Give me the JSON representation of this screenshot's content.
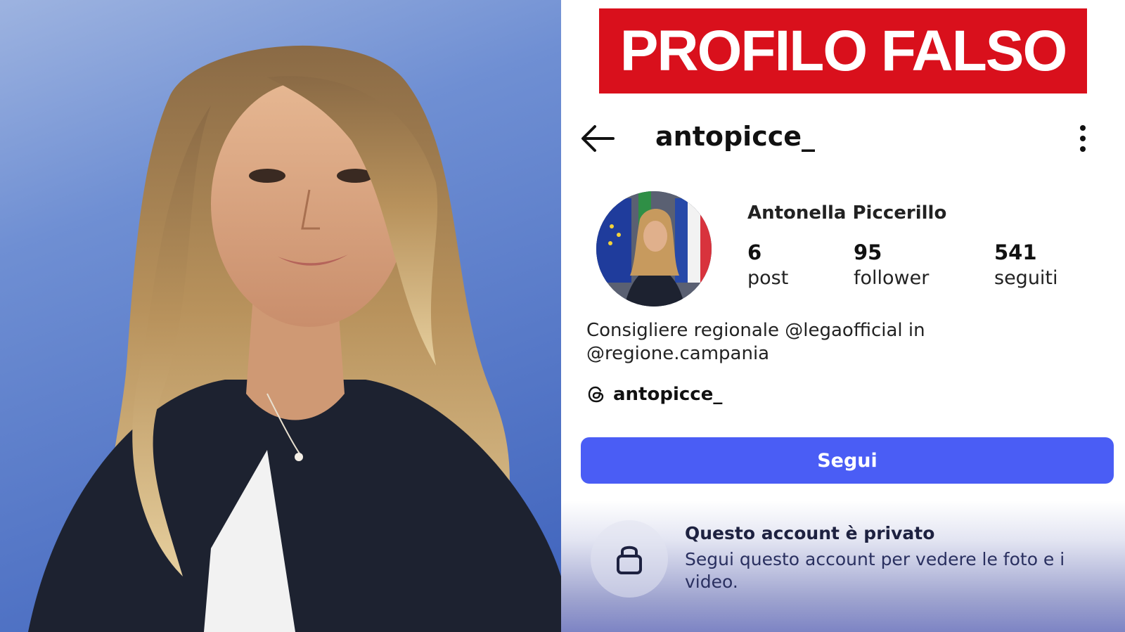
{
  "banner": {
    "text": "PROFILO FALSO",
    "color": "#d9101c"
  },
  "header": {
    "handle": "antopicce_",
    "back_icon": "arrow-left-icon",
    "more_icon": "more-vertical-icon"
  },
  "profile": {
    "display_name": "Antonella Piccerillo",
    "stats": [
      {
        "value": "6",
        "label": "post"
      },
      {
        "value": "95",
        "label": "follower"
      },
      {
        "value": "541",
        "label": "seguiti"
      }
    ],
    "bio_line1": "Consigliere regionale @legaofficial in",
    "bio_line2": "@regione.campania",
    "threads_handle": "antopicce_",
    "threads_icon": "threads-icon"
  },
  "follow_button": {
    "label": "Segui",
    "color": "#4a5df5"
  },
  "private_notice": {
    "title": "Questo account è privato",
    "description": "Segui questo account per vedere le foto e i video.",
    "icon": "lock-icon"
  }
}
